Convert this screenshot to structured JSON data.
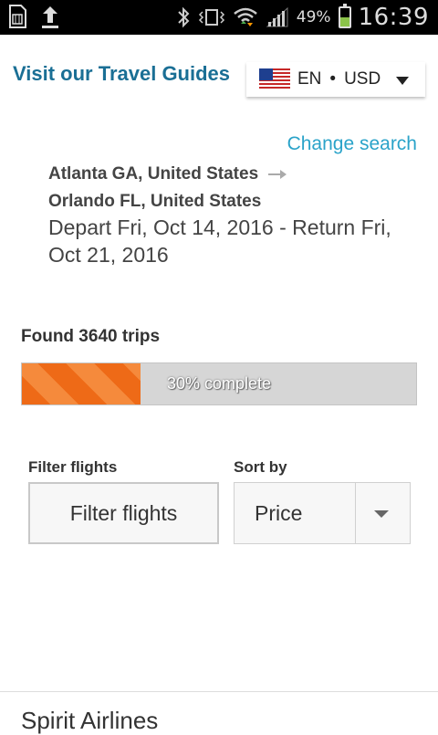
{
  "status_bar": {
    "battery_percent": "49%",
    "battery_level": 0.49,
    "time": "16:39",
    "icons": [
      "sim-icon",
      "upload-icon",
      "bluetooth-icon",
      "vibrate-icon",
      "wifi-icon",
      "signal-icon",
      "battery-icon"
    ]
  },
  "header": {
    "travel_guides": "Visit our Travel Guides",
    "language": "EN",
    "separator": "•",
    "currency": "USD",
    "flag": "us-flag-icon"
  },
  "search": {
    "change_search": "Change search",
    "origin": "Atlanta GA, United States",
    "destination": "Orlando FL, United States",
    "dates": "Depart Fri, Oct 14, 2016 - Return Fri, Oct 21, 2016"
  },
  "results": {
    "found": "Found 3640 trips",
    "progress_fraction": 0.3,
    "progress_label": "30% complete"
  },
  "controls": {
    "filter_label": "Filter flights",
    "filter_button": "Filter flights",
    "sort_label": "Sort by",
    "sort_value": "Price"
  },
  "result_card": {
    "airline": "Spirit Airlines"
  },
  "colors": {
    "accent_link": "#1a6f95",
    "change_search": "#2aa3c9",
    "progress_orange": "#ee6a17"
  }
}
